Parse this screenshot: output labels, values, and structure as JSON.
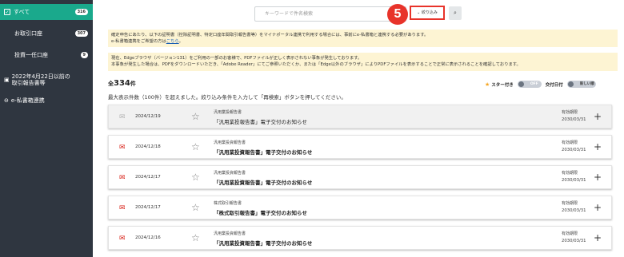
{
  "sidebar": {
    "all": {
      "label": "すべて",
      "count": "316"
    },
    "items": [
      {
        "label": "お取引口座",
        "count": "307"
      },
      {
        "label": "投資一任口座",
        "count": "9"
      }
    ],
    "legacy": {
      "line1": "2022年4月22日以前の",
      "line2": "取引報告書等"
    },
    "ebox": {
      "label": "e-私書箱連携"
    }
  },
  "search": {
    "placeholder": "キーワードで件名検索",
    "filter_label": "⌄ 絞り込み",
    "search_icon": "magnifier-icon",
    "step_number": "5"
  },
  "notices": {
    "notice1_line1": "確定申告にあたり、以下の証明書（控除証明書、特定口座年間取引報告書等）をマイナポータル連携で利用する場合には、事前にe-私書箱と連携する必要があります。",
    "notice1_line2_prefix": "e-私書箱連携をご希望の方は",
    "notice1_link": "こちら",
    "notice1_line2_suffix": "。",
    "notice2_line1": "現在、Edgeブラウザ（バージョン131）をご利用の一部のお客様で、PDFファイルが正しく表示されない事象が発生しております。",
    "notice2_line2": "本事象が発生した場合は、PDFをダウンロードいただき、「Adobe Reader」にてご参照いただくか、または「Edge以外のブラウザ」によりPDFファイルを表示することで正常に表示されることを確認しております。"
  },
  "summary": {
    "prefix": "全",
    "count": "334",
    "suffix": "件",
    "max_note": "最大表示件数（100件）を超えました。絞り込み条件を入力して「再検索」ボタンを押してください。"
  },
  "toggles": {
    "starred_label": "スター付き",
    "starred_state": "OFF",
    "date_label": "交付日付",
    "order_state": "新しい順"
  },
  "rows": [
    {
      "date": "2024/12/19",
      "category": "汎用業投報告書",
      "title": "「汎用業投報告書」電子交付のお知らせ",
      "deadline_label": "有効期限",
      "deadline": "2030/03/31",
      "read": true
    },
    {
      "date": "2024/12/18",
      "category": "汎用業投資報告書",
      "title": "「汎用業投資報告書」電子交付のお知らせ",
      "deadline_label": "有効期限",
      "deadline": "2030/03/31",
      "read": false
    },
    {
      "date": "2024/12/17",
      "category": "汎用業投資報告書",
      "title": "「汎用業投資報告書」電子交付のお知らせ",
      "deadline_label": "有効期限",
      "deadline": "2030/03/31",
      "read": false
    },
    {
      "date": "2024/12/17",
      "category": "株式取引報告書",
      "title": "「株式取引報告書」電子交付のお知らせ",
      "deadline_label": "有効期限",
      "deadline": "2030/03/31",
      "read": false
    },
    {
      "date": "2024/12/16",
      "category": "汎用業投資報告書",
      "title": "「汎用業投資報告書」電子交付のお知らせ",
      "deadline_label": "有効期限",
      "deadline": "2030/03/31",
      "read": false
    }
  ],
  "colors": {
    "sidebar": "#2f3640",
    "active": "#1aa98c",
    "accent_red": "#e8332a",
    "notice_bg": "#fdf4d3"
  }
}
